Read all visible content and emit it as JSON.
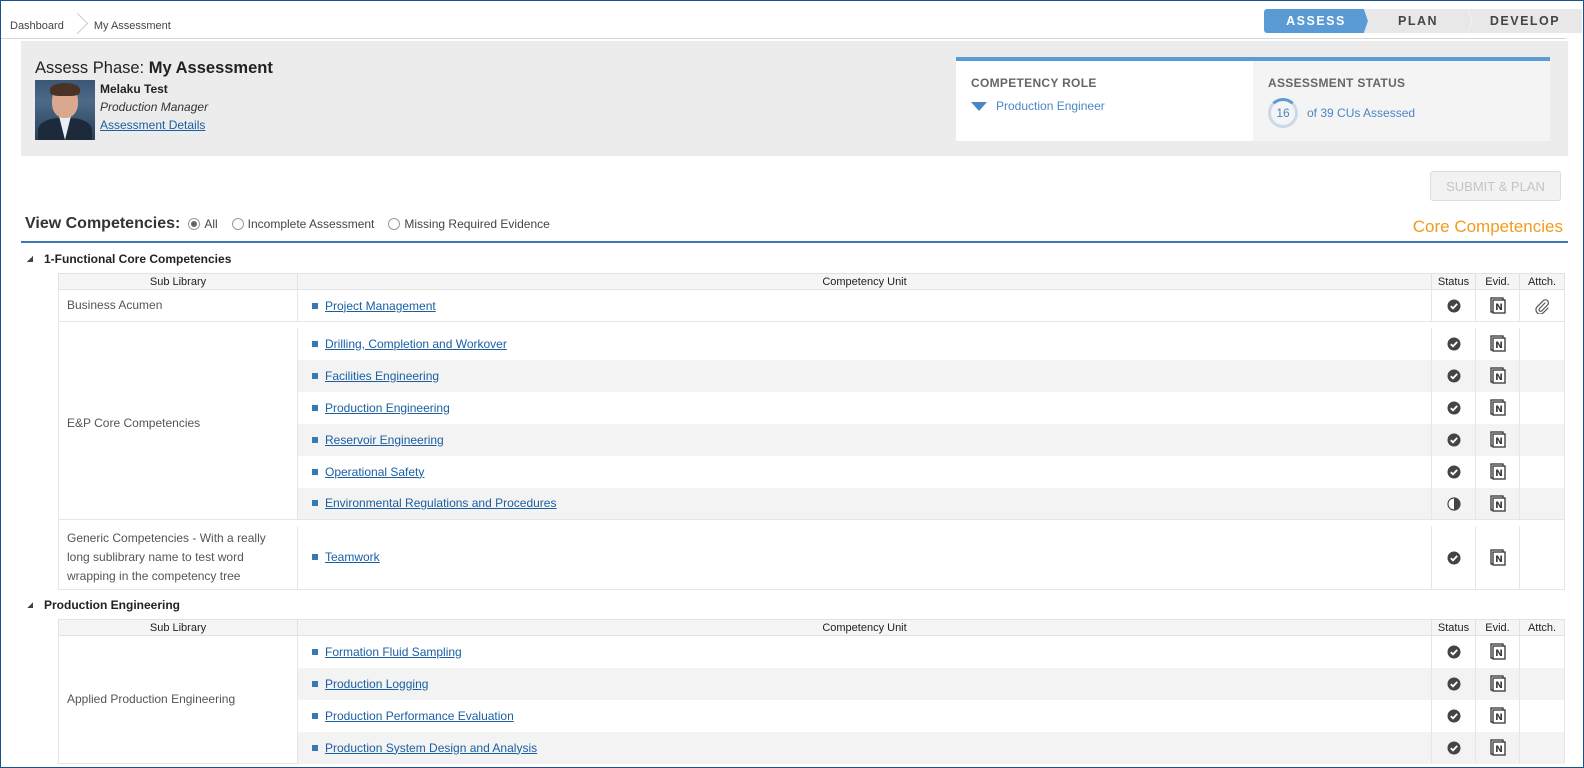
{
  "breadcrumb": [
    "Dashboard",
    "My Assessment"
  ],
  "phases": [
    {
      "label": "ASSESS",
      "active": true
    },
    {
      "label": "PLAN",
      "active": false
    },
    {
      "label": "DEVELOP",
      "active": false
    }
  ],
  "header": {
    "phase_prefix": "Assess Phase: ",
    "phase_name": "My Assessment",
    "user_name": "Melaku Test",
    "user_title": "Production Manager",
    "details_link": "Assessment Details"
  },
  "competency_role": {
    "label": "COMPETENCY ROLE",
    "value": "Production Engineer"
  },
  "assessment_status": {
    "label": "ASSESSMENT STATUS",
    "assessed": "16",
    "text": "of 39 CUs Assessed"
  },
  "submit_label": "SUBMIT & PLAN",
  "filter": {
    "label": "View Competencies:",
    "options": [
      "All",
      "Incomplete Assessment",
      "Missing Required Evidence"
    ],
    "selected": "All"
  },
  "section_title": "Core Competencies",
  "columns": {
    "sub": "Sub Library",
    "unit": "Competency Unit",
    "status": "Status",
    "evid": "Evid.",
    "attch": "Attch."
  },
  "colors": {
    "accent": "#5b9bd5",
    "link": "#1a5fa3",
    "orange": "#f29a1f"
  },
  "groups": [
    {
      "title": "1-Functional Core Competencies",
      "sublibs": [
        {
          "name": "Business Acumen",
          "units": [
            {
              "name": "Project Management",
              "status": "complete",
              "attach": true
            }
          ]
        },
        {
          "name": "E&P Core Competencies",
          "units": [
            {
              "name": "Drilling, Completion and Workover",
              "status": "complete"
            },
            {
              "name": "Facilities Engineering",
              "status": "complete"
            },
            {
              "name": "Production Engineering",
              "status": "complete"
            },
            {
              "name": "Reservoir Engineering",
              "status": "complete"
            },
            {
              "name": "Operational Safety",
              "status": "complete"
            },
            {
              "name": "Environmental Regulations and Procedures",
              "status": "partial"
            }
          ]
        },
        {
          "name": "Generic Competencies - With a really long sublibrary name to test word wrapping in the competency tree",
          "units": [
            {
              "name": "Teamwork",
              "status": "complete"
            }
          ]
        }
      ]
    },
    {
      "title": "Production Engineering",
      "sublibs": [
        {
          "name": "Applied Production Engineering",
          "units": [
            {
              "name": "Formation Fluid Sampling",
              "status": "complete"
            },
            {
              "name": "Production Logging",
              "status": "complete"
            },
            {
              "name": "Production Performance Evaluation",
              "status": "complete"
            },
            {
              "name": "Production System Design and Analysis",
              "status": "complete"
            }
          ]
        }
      ]
    }
  ]
}
